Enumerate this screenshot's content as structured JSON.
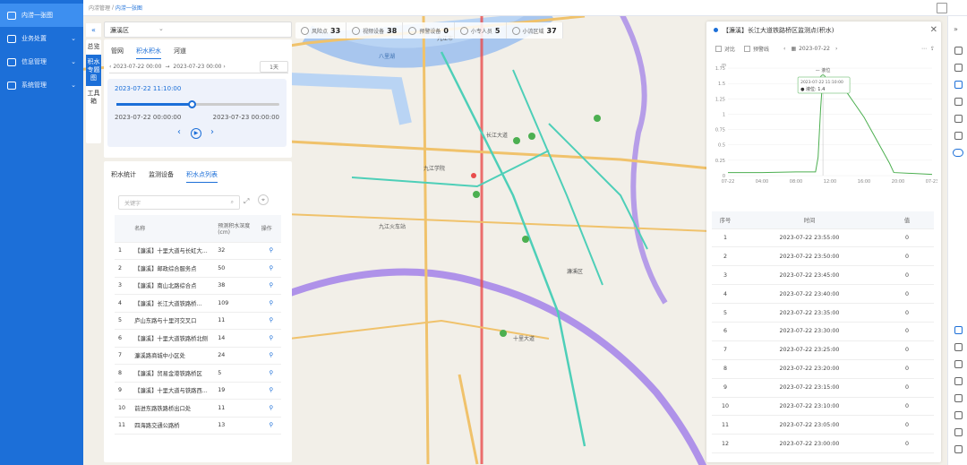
{
  "sidebar": {
    "items": [
      {
        "label": "内涝一张图",
        "active": true
      },
      {
        "label": "业务处置",
        "active": false
      },
      {
        "label": "信息管理",
        "active": false
      },
      {
        "label": "系统管理",
        "active": false
      }
    ]
  },
  "breadcrumb": {
    "root": "内涝管理",
    "sep": "/",
    "current": "内涝一张图"
  },
  "district": "濂溪区",
  "stats": [
    {
      "label": "风险点",
      "value": "33"
    },
    {
      "label": "视频设备",
      "value": "38"
    },
    {
      "label": "预警设备",
      "value": "0"
    },
    {
      "label": "小专人员",
      "value": "5"
    },
    {
      "label": "小流区域",
      "value": "37"
    }
  ],
  "vtabs": [
    "总览",
    "积水专题图",
    "工具箱"
  ],
  "panel1": {
    "tabs": [
      "管网",
      "积水积水",
      "河道"
    ],
    "start_date": "2023-07-22 00:00",
    "arrow": "→",
    "end_date": "2023-07-23 00:00",
    "interval": "1天",
    "current_time": "2023-07-22 11:10:00",
    "range_start": "2023-07-22 00:00:00",
    "range_end": "2023-07-23 00:00:00",
    "progress": 0.46
  },
  "panel2": {
    "tabs": [
      "积水统计",
      "监测设备",
      "积水点列表"
    ],
    "search_placeholder": "关键字",
    "headers": [
      "",
      "名称",
      "预测积水深度(cm)",
      "操作"
    ],
    "rows": [
      {
        "no": "1",
        "name": "【濂溪】十里大道与长虹大...",
        "depth": "32"
      },
      {
        "no": "2",
        "name": "【濂溪】邮政综合服务点",
        "depth": "50"
      },
      {
        "no": "3",
        "name": "【濂溪】南山北路综合点",
        "depth": "38"
      },
      {
        "no": "4",
        "name": "【濂溪】长江大道铁路桥...",
        "depth": "109"
      },
      {
        "no": "5",
        "name": "庐山东路与十里河交叉口",
        "depth": "11"
      },
      {
        "no": "6",
        "name": "【濂溪】十里大道铁路桥北侧",
        "depth": "14"
      },
      {
        "no": "7",
        "name": "濂溪路商城中小区处",
        "depth": "24"
      },
      {
        "no": "8",
        "name": "【濂溪】贸易金港铁路桥区",
        "depth": "5"
      },
      {
        "no": "9",
        "name": "【濂溪】十里大道与铁路西...",
        "depth": "19"
      },
      {
        "no": "10",
        "name": "前进东路铁路桥出口处",
        "depth": "11"
      },
      {
        "no": "11",
        "name": "四海路交通公路桥",
        "depth": "13"
      }
    ]
  },
  "panel3": {
    "title": "【濂溪】长江大道铁路桥区监测点(积水)",
    "compare": "对比",
    "warn_line": "预警线",
    "date": "2023-07-22",
    "headers": [
      "序号",
      "时间",
      "值"
    ],
    "rows": [
      {
        "no": "1",
        "time": "2023-07-22 23:55:00",
        "val": "0"
      },
      {
        "no": "2",
        "time": "2023-07-22 23:50:00",
        "val": "0"
      },
      {
        "no": "3",
        "time": "2023-07-22 23:45:00",
        "val": "0"
      },
      {
        "no": "4",
        "time": "2023-07-22 23:40:00",
        "val": "0"
      },
      {
        "no": "5",
        "time": "2023-07-22 23:35:00",
        "val": "0"
      },
      {
        "no": "6",
        "time": "2023-07-22 23:30:00",
        "val": "0"
      },
      {
        "no": "7",
        "time": "2023-07-22 23:25:00",
        "val": "0"
      },
      {
        "no": "8",
        "time": "2023-07-22 23:20:00",
        "val": "0"
      },
      {
        "no": "9",
        "time": "2023-07-22 23:15:00",
        "val": "0"
      },
      {
        "no": "10",
        "time": "2023-07-22 23:10:00",
        "val": "0"
      },
      {
        "no": "11",
        "time": "2023-07-22 23:05:00",
        "val": "0"
      },
      {
        "no": "12",
        "time": "2023-07-22 23:00:00",
        "val": "0"
      }
    ]
  },
  "chart_data": {
    "type": "line",
    "ylabel": "m",
    "ylim": [
      0,
      1.75
    ],
    "yticks": [
      "0",
      "0.25",
      "0.5",
      "0.75",
      "1",
      "1.25",
      "1.5",
      "1.75"
    ],
    "xticks": [
      "07-22",
      "04:00",
      "08:00",
      "12:00",
      "16:00",
      "20:00",
      "07-23"
    ],
    "tooltip": {
      "time": "2023-07-22 11:10:00",
      "series": "液位",
      "value": "1.4"
    },
    "series": [
      {
        "name": "液位",
        "color": "#4caf50",
        "points": [
          [
            0,
            0.05
          ],
          [
            4,
            0.05
          ],
          [
            8,
            0.06
          ],
          [
            10.3,
            0.06
          ],
          [
            10.6,
            0.3
          ],
          [
            10.9,
            1.1
          ],
          [
            11.1,
            1.5
          ],
          [
            11.3,
            1.6
          ],
          [
            12,
            1.58
          ],
          [
            13,
            1.52
          ],
          [
            14,
            1.35
          ],
          [
            15,
            1.15
          ],
          [
            16,
            0.95
          ],
          [
            17,
            0.7
          ],
          [
            18,
            0.45
          ],
          [
            19,
            0.2
          ],
          [
            19.5,
            0.05
          ],
          [
            24,
            0.02
          ]
        ]
      }
    ]
  },
  "map_labels": [
    "九江市",
    "八里湖",
    "九江学院",
    "濂溪区",
    "九江火车站",
    "长江大道",
    "十里大道"
  ],
  "colors": {
    "primary": "#1c6fd8",
    "line": "#4caf50"
  }
}
